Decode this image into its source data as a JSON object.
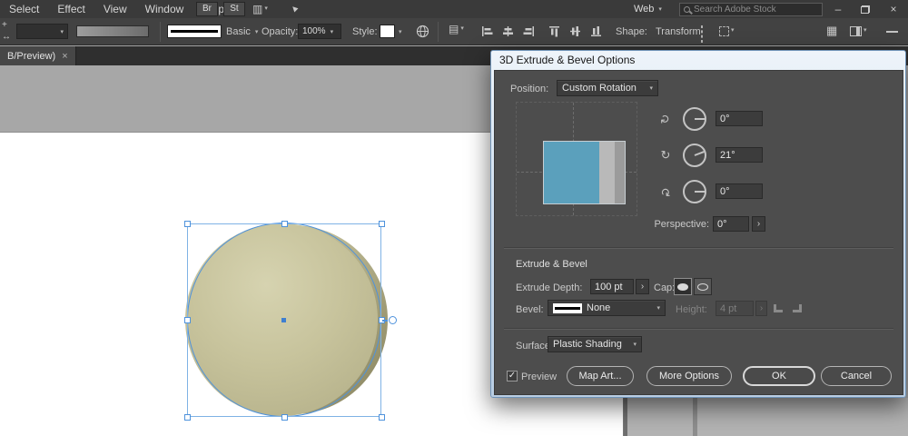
{
  "colors": {
    "accent_selection": "#4e92dc",
    "circle_fill": "#c6c29c",
    "circle_extrusion": "#9d9974",
    "cube_face": "#5ba0bc",
    "dialog_panel": "#4d4d4d"
  },
  "icons": {
    "chevron": "▾",
    "chevron_right": "›",
    "close": "×",
    "minimize": "–",
    "check": "✓",
    "rotate": "↻",
    "grid": "▦",
    "doc_page": "▤",
    "arrange_docs": "▥",
    "gpu": "▲",
    "ref_point": "+",
    "constrain": "↔"
  },
  "menubar": {
    "items": [
      "Select",
      "Effect",
      "View",
      "Window",
      "Help"
    ],
    "br": "Br",
    "st": "St",
    "web": "Web",
    "search_placeholder": "Search Adobe Stock"
  },
  "toolbar": {
    "brush": "Basic",
    "opacity_label": "Opacity:",
    "opacity": "100%",
    "style_label": "Style:",
    "shape_label": "Shape:",
    "transform_label": "Transform"
  },
  "tabs": {
    "doc_tab": "B/Preview)"
  },
  "dialog": {
    "title": "3D Extrude & Bevel Options",
    "position": {
      "label": "Position:",
      "value": "Custom Rotation"
    },
    "rot_x": "0°",
    "rot_y": "21°",
    "rot_z": "0°",
    "perspective": {
      "label": "Perspective:",
      "value": "0°"
    },
    "section_extrude": "Extrude & Bevel",
    "extrude_depth": {
      "label": "Extrude Depth:",
      "value": "100 pt"
    },
    "cap_label": "Cap:",
    "bevel": {
      "label": "Bevel:",
      "value": "None"
    },
    "height": {
      "label": "Height:",
      "value": "4 pt"
    },
    "surface": {
      "label": "Surface:",
      "value": "Plastic Shading"
    },
    "preview": "Preview",
    "buttons": {
      "map_art": "Map Art...",
      "more_options": "More Options",
      "ok": "OK",
      "cancel": "Cancel"
    }
  }
}
